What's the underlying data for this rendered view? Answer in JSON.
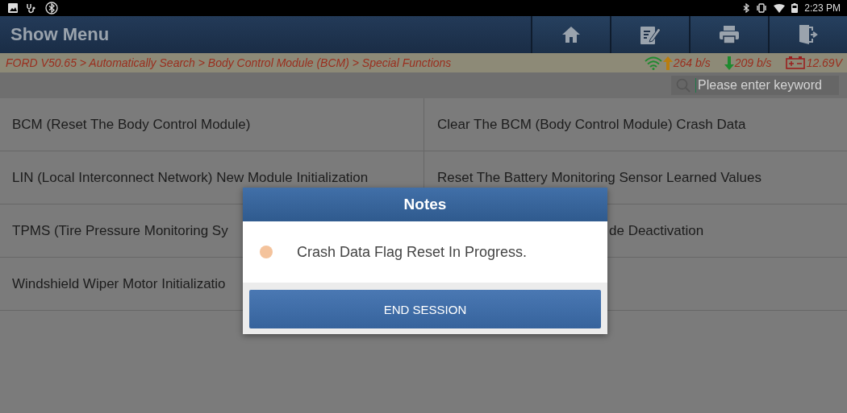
{
  "status_bar": {
    "time": "2:23 PM"
  },
  "header": {
    "title": "Show Menu"
  },
  "breadcrumb": {
    "path": "FORD V50.65 > Automatically Search > Body Control Module (BCM) > Special Functions",
    "upload": "264 b/s",
    "download": "209 b/s",
    "voltage": "12.69V"
  },
  "search": {
    "placeholder": "Please enter keyword"
  },
  "menu_items": [
    {
      "label": "BCM (Reset The Body Control Module)",
      "start_hidden": false
    },
    {
      "label": "Clear The BCM (Body Control Module) Crash Data",
      "start_hidden": false
    },
    {
      "label": "LIN (Local Interconnect Network) New Module Initialization",
      "start_hidden": false
    },
    {
      "label": "Reset The Battery Monitoring Sensor Learned Values",
      "start_hidden": false
    },
    {
      "label": "TPMS (Tire Pressure Monitoring Sy",
      "start_hidden": false
    },
    {
      "label": "de Deactivation",
      "start_hidden": true
    },
    {
      "label": "Windshield Wiper Motor Initializatio",
      "start_hidden": false
    }
  ],
  "dialog": {
    "title": "Notes",
    "message": "Crash Data Flag Reset In Progress.",
    "button": "END SESSION"
  }
}
